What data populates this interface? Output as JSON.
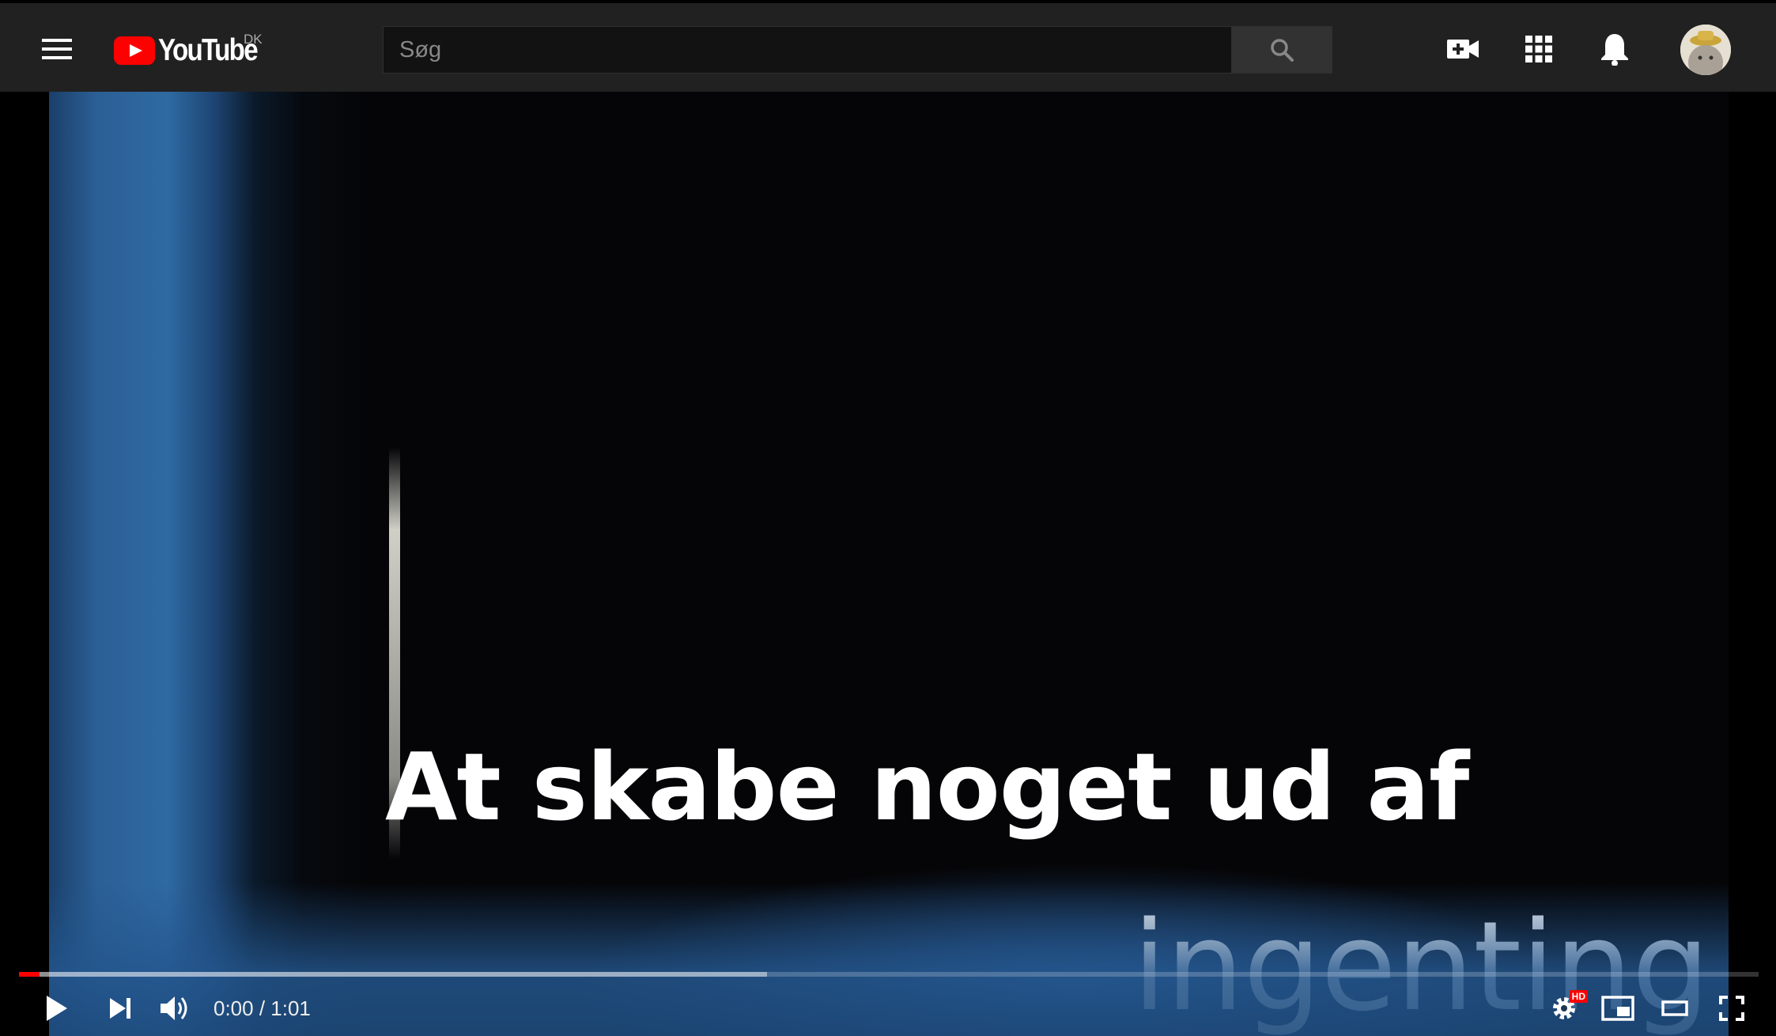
{
  "header": {
    "logo_text": "YouTube",
    "region": "DK",
    "search_placeholder": "Søg"
  },
  "video": {
    "caption_line1": "At skabe noget ud af",
    "caption_line2": "ingenting",
    "current_time": "0:00",
    "duration": "1:01",
    "time_display": "0:00 / 1:01",
    "progress_played_fraction": 0.012,
    "progress_loaded_fraction": 0.43,
    "settings_badge": "HD"
  },
  "colors": {
    "header_bg": "#212121",
    "brand_red": "#ff0000"
  },
  "icons": [
    "menu-icon",
    "youtube-logo-icon",
    "search-icon",
    "create-video-icon",
    "apps-grid-icon",
    "bell-icon",
    "play-icon",
    "next-icon",
    "volume-icon",
    "settings-gear-icon",
    "miniplayer-icon",
    "theater-mode-icon",
    "fullscreen-icon"
  ]
}
